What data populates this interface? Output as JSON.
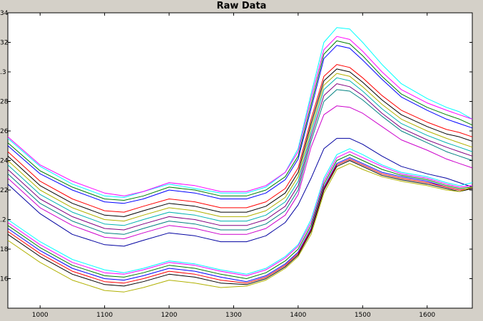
{
  "window": {
    "title": "Raw Data"
  },
  "chart_data": {
    "type": "line",
    "title": "Raw Data",
    "xlabel": "",
    "ylabel": "",
    "xlim": [
      950,
      1670
    ],
    "ylim": [
      0.14,
      0.34
    ],
    "x_ticks": [
      1000,
      1100,
      1200,
      1300,
      1400,
      1500,
      1600
    ],
    "x_tick_labels": [
      "1000",
      "1100",
      "1200",
      "1300",
      "1400",
      "1500",
      "1600"
    ],
    "y_ticks": [
      0.16,
      0.18,
      0.2,
      0.22,
      0.24,
      0.26,
      0.28,
      0.3,
      0.32,
      0.34
    ],
    "y_tick_labels": [
      "16",
      "18",
      ".2",
      "22",
      "24",
      "26",
      "28",
      ".3",
      "32",
      "34"
    ],
    "x": [
      950,
      1000,
      1050,
      1100,
      1130,
      1160,
      1200,
      1240,
      1280,
      1320,
      1350,
      1380,
      1400,
      1420,
      1440,
      1460,
      1480,
      1500,
      1530,
      1560,
      1600,
      1630,
      1650,
      1670
    ],
    "grid": false,
    "legend": "none",
    "colors": [
      "#00ffff",
      "#ff00ff",
      "#008000",
      "#0000ff",
      "#ff0000",
      "#000000",
      "#b0b000",
      "#00b0b0",
      "#800080",
      "#008080",
      "#cc00cc",
      "#0000a0"
    ],
    "series": [
      {
        "values": [
          0.255,
          0.236,
          0.224,
          0.216,
          0.215,
          0.219,
          0.224,
          0.221,
          0.218,
          0.218,
          0.222,
          0.232,
          0.248,
          0.285,
          0.32,
          0.33,
          0.329,
          0.32,
          0.305,
          0.292,
          0.282,
          0.276,
          0.273,
          0.268
        ]
      },
      {
        "values": [
          0.256,
          0.237,
          0.226,
          0.218,
          0.216,
          0.219,
          0.225,
          0.223,
          0.219,
          0.219,
          0.223,
          0.232,
          0.246,
          0.282,
          0.315,
          0.324,
          0.322,
          0.314,
          0.3,
          0.288,
          0.279,
          0.274,
          0.271,
          0.268
        ]
      },
      {
        "values": [
          0.252,
          0.233,
          0.222,
          0.214,
          0.213,
          0.216,
          0.222,
          0.22,
          0.216,
          0.216,
          0.22,
          0.229,
          0.243,
          0.278,
          0.312,
          0.321,
          0.319,
          0.311,
          0.297,
          0.285,
          0.276,
          0.271,
          0.268,
          0.264
        ]
      },
      {
        "values": [
          0.25,
          0.231,
          0.22,
          0.212,
          0.211,
          0.214,
          0.22,
          0.218,
          0.214,
          0.214,
          0.218,
          0.227,
          0.241,
          0.275,
          0.309,
          0.318,
          0.316,
          0.308,
          0.295,
          0.283,
          0.274,
          0.268,
          0.265,
          0.262
        ]
      },
      {
        "values": [
          0.246,
          0.226,
          0.214,
          0.206,
          0.205,
          0.209,
          0.214,
          0.212,
          0.208,
          0.208,
          0.212,
          0.221,
          0.235,
          0.268,
          0.297,
          0.305,
          0.303,
          0.296,
          0.284,
          0.274,
          0.266,
          0.261,
          0.259,
          0.256
        ]
      },
      {
        "values": [
          0.243,
          0.223,
          0.211,
          0.203,
          0.202,
          0.206,
          0.211,
          0.209,
          0.205,
          0.205,
          0.209,
          0.218,
          0.232,
          0.265,
          0.294,
          0.302,
          0.3,
          0.293,
          0.281,
          0.271,
          0.263,
          0.258,
          0.256,
          0.253
        ]
      },
      {
        "values": [
          0.24,
          0.22,
          0.208,
          0.2,
          0.199,
          0.203,
          0.208,
          0.206,
          0.202,
          0.202,
          0.206,
          0.215,
          0.229,
          0.262,
          0.291,
          0.299,
          0.297,
          0.29,
          0.278,
          0.268,
          0.26,
          0.255,
          0.252,
          0.249
        ]
      },
      {
        "values": [
          0.237,
          0.217,
          0.205,
          0.197,
          0.196,
          0.2,
          0.205,
          0.203,
          0.199,
          0.199,
          0.203,
          0.212,
          0.226,
          0.259,
          0.288,
          0.296,
          0.294,
          0.287,
          0.275,
          0.265,
          0.257,
          0.252,
          0.249,
          0.246
        ]
      },
      {
        "values": [
          0.234,
          0.214,
          0.202,
          0.194,
          0.193,
          0.197,
          0.202,
          0.2,
          0.196,
          0.196,
          0.2,
          0.209,
          0.223,
          0.256,
          0.284,
          0.292,
          0.29,
          0.284,
          0.272,
          0.262,
          0.254,
          0.249,
          0.246,
          0.243
        ]
      },
      {
        "values": [
          0.231,
          0.211,
          0.199,
          0.191,
          0.19,
          0.194,
          0.199,
          0.197,
          0.193,
          0.193,
          0.197,
          0.206,
          0.22,
          0.253,
          0.28,
          0.288,
          0.287,
          0.281,
          0.27,
          0.26,
          0.252,
          0.246,
          0.243,
          0.24
        ]
      },
      {
        "values": [
          0.228,
          0.208,
          0.196,
          0.188,
          0.187,
          0.191,
          0.196,
          0.194,
          0.19,
          0.19,
          0.194,
          0.203,
          0.217,
          0.249,
          0.271,
          0.277,
          0.276,
          0.272,
          0.263,
          0.254,
          0.247,
          0.241,
          0.238,
          0.235
        ]
      },
      {
        "values": [
          0.224,
          0.204,
          0.19,
          0.183,
          0.182,
          0.186,
          0.191,
          0.189,
          0.185,
          0.185,
          0.189,
          0.198,
          0.21,
          0.228,
          0.248,
          0.255,
          0.255,
          0.251,
          0.243,
          0.236,
          0.231,
          0.228,
          0.225,
          0.222
        ]
      },
      {
        "values": [
          0.2,
          0.185,
          0.173,
          0.166,
          0.164,
          0.167,
          0.172,
          0.17,
          0.166,
          0.163,
          0.167,
          0.175,
          0.183,
          0.2,
          0.228,
          0.244,
          0.248,
          0.244,
          0.237,
          0.232,
          0.229,
          0.225,
          0.223,
          0.225
        ]
      },
      {
        "values": [
          0.198,
          0.183,
          0.171,
          0.164,
          0.163,
          0.166,
          0.171,
          0.169,
          0.165,
          0.162,
          0.166,
          0.174,
          0.182,
          0.198,
          0.226,
          0.242,
          0.246,
          0.242,
          0.236,
          0.231,
          0.228,
          0.224,
          0.222,
          0.223
        ]
      },
      {
        "values": [
          0.196,
          0.181,
          0.169,
          0.162,
          0.161,
          0.164,
          0.169,
          0.167,
          0.163,
          0.16,
          0.164,
          0.172,
          0.18,
          0.196,
          0.224,
          0.24,
          0.244,
          0.24,
          0.234,
          0.23,
          0.227,
          0.223,
          0.221,
          0.222
        ]
      },
      {
        "values": [
          0.194,
          0.179,
          0.167,
          0.16,
          0.159,
          0.162,
          0.167,
          0.165,
          0.161,
          0.158,
          0.162,
          0.17,
          0.178,
          0.194,
          0.222,
          0.238,
          0.242,
          0.238,
          0.232,
          0.229,
          0.226,
          0.222,
          0.22,
          0.221
        ]
      },
      {
        "values": [
          0.192,
          0.177,
          0.165,
          0.158,
          0.157,
          0.16,
          0.165,
          0.163,
          0.159,
          0.157,
          0.161,
          0.169,
          0.177,
          0.193,
          0.221,
          0.237,
          0.241,
          0.237,
          0.231,
          0.228,
          0.225,
          0.222,
          0.22,
          0.221
        ]
      },
      {
        "values": [
          0.19,
          0.175,
          0.163,
          0.156,
          0.155,
          0.158,
          0.163,
          0.161,
          0.157,
          0.156,
          0.16,
          0.168,
          0.176,
          0.192,
          0.22,
          0.236,
          0.24,
          0.236,
          0.23,
          0.227,
          0.224,
          0.221,
          0.219,
          0.221
        ]
      },
      {
        "values": [
          0.186,
          0.171,
          0.159,
          0.152,
          0.151,
          0.154,
          0.159,
          0.157,
          0.154,
          0.155,
          0.159,
          0.167,
          0.175,
          0.19,
          0.218,
          0.234,
          0.238,
          0.234,
          0.229,
          0.226,
          0.223,
          0.22,
          0.219,
          0.222
        ]
      }
    ]
  }
}
